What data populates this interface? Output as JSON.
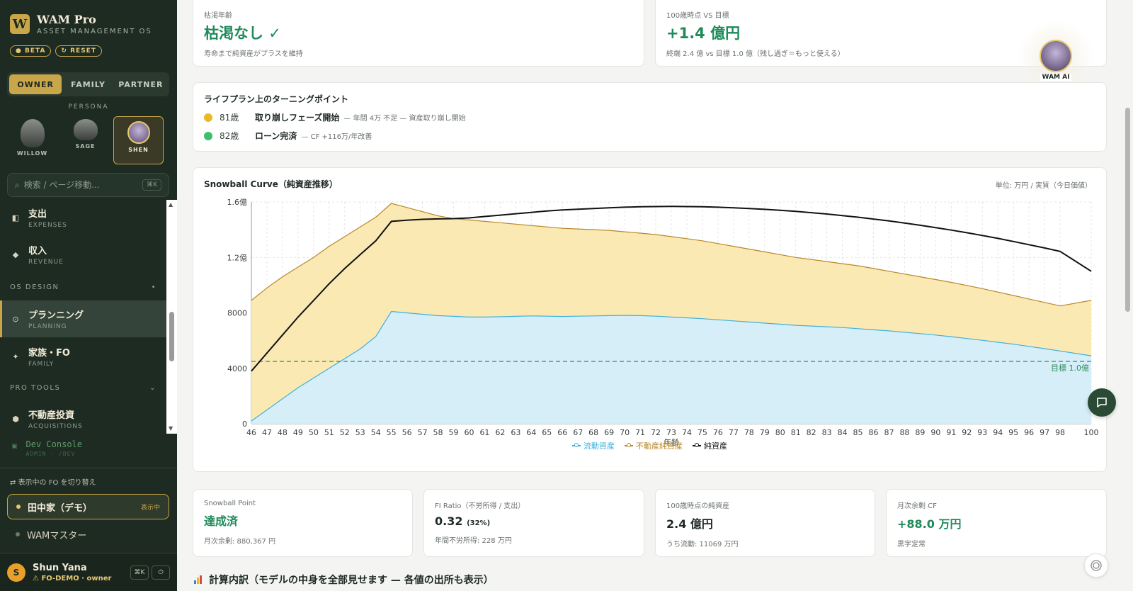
{
  "brand": {
    "logo": "W",
    "name": "WAM Pro",
    "subtitle": "ASSET MANAGEMENT OS",
    "badge_beta": "BETA",
    "badge_reset": "RESET"
  },
  "role_tabs": [
    {
      "label": "OWNER",
      "active": true
    },
    {
      "label": "FAMILY",
      "active": false
    },
    {
      "label": "PARTNER",
      "active": false
    }
  ],
  "persona": {
    "label": "PERSONA",
    "items": [
      {
        "name": "WILLOW",
        "active": false
      },
      {
        "name": "SAGE",
        "active": false
      },
      {
        "name": "SHEN",
        "active": true
      }
    ]
  },
  "search": {
    "placeholder": "検索 / ページ移動...",
    "shortcut": "⌘K"
  },
  "nav": {
    "items": [
      {
        "label": "支出",
        "sub": "EXPENSES",
        "icon": "expenses-icon"
      },
      {
        "label": "収入",
        "sub": "REVENUE",
        "icon": "revenue-icon"
      },
      {
        "label": "プランニング",
        "sub": "PLANNING",
        "icon": "planning-icon",
        "active": true
      },
      {
        "label": "家族・FO",
        "sub": "FAMILY",
        "icon": "family-icon"
      },
      {
        "label": "不動産投資",
        "sub": "ACQUISITIONS",
        "icon": "acquisitions-icon"
      }
    ],
    "section_os_design": "OS DESIGN",
    "section_pro_tools": "PRO TOOLS",
    "dev_label": "Dev Console",
    "dev_sub": "ADMIN · /DEV"
  },
  "fo": {
    "switch_label": "表示中の FO を切り替え",
    "items": [
      {
        "label": "田中家（デモ）",
        "tag": "表示中",
        "active": true
      },
      {
        "label": "WAMマスター",
        "tag": "",
        "active": false
      }
    ]
  },
  "user": {
    "initial": "S",
    "name": "Shun Yana",
    "role": "⚠ FO-DEMO · owner",
    "shortcut": "⌘K",
    "power": "⏻"
  },
  "top_cards": {
    "depletion": {
      "label": "枯渇年齢",
      "value": "枯渇なし ✓",
      "note": "寿命まで純資産がプラスを維持"
    },
    "target": {
      "label": "100歳時点 VS 目標",
      "value": "+1.4 億円",
      "note": "終端 2.4 億 vs 目標 1.0 億（残し過ぎ＝もっと使える）"
    }
  },
  "turning_points": {
    "title": "ライフプラン上のターニングポイント",
    "items": [
      {
        "age": "81歳",
        "event": "取り崩しフェーズ開始",
        "detail": "— 年間 4万 不足 — 資産取り崩し開始",
        "color": "#e8b92a"
      },
      {
        "age": "82歳",
        "event": "ローン完済",
        "detail": "— CF +116万/年改善",
        "color": "#3cc070"
      }
    ]
  },
  "chart_data": {
    "type": "area",
    "title": "Snowball Curve（純資産推移）",
    "unit_note": "単位: 万円 / 実質（今日価値）",
    "xlabel": "年齢",
    "x": [
      46,
      47,
      48,
      49,
      50,
      51,
      52,
      53,
      54,
      55,
      56,
      57,
      58,
      59,
      60,
      61,
      62,
      63,
      64,
      65,
      66,
      67,
      68,
      69,
      70,
      71,
      72,
      73,
      74,
      75,
      76,
      77,
      78,
      79,
      80,
      81,
      82,
      83,
      84,
      85,
      86,
      87,
      88,
      89,
      90,
      91,
      92,
      93,
      94,
      95,
      96,
      97,
      98,
      100
    ],
    "y_ticks": [
      {
        "v": 0,
        "label": "0"
      },
      {
        "v": 4000,
        "label": "4000"
      },
      {
        "v": 8000,
        "label": "8000"
      },
      {
        "v": 12000,
        "label": "1.2億"
      },
      {
        "v": 16000,
        "label": "1.6億"
      }
    ],
    "ylim": [
      0,
      16000
    ],
    "series": [
      {
        "name": "流動資産",
        "color": "#3fb1dc",
        "fill": "#d6eef8",
        "values": [
          200,
          1000,
          1800,
          2600,
          3300,
          4000,
          4700,
          5400,
          6300,
          8100,
          8000,
          7900,
          7800,
          7750,
          7700,
          7700,
          7720,
          7750,
          7780,
          7760,
          7740,
          7760,
          7780,
          7800,
          7820,
          7800,
          7760,
          7700,
          7640,
          7580,
          7500,
          7420,
          7340,
          7260,
          7180,
          7100,
          7050,
          7000,
          6940,
          6860,
          6780,
          6700,
          6600,
          6500,
          6400,
          6280,
          6150,
          6020,
          5880,
          5740,
          5580,
          5420,
          5250,
          4900
        ]
      },
      {
        "name": "不動産純資産",
        "color": "#b8872a",
        "fill": "#fbe9b4",
        "values": [
          8900,
          9800,
          10600,
          11300,
          12000,
          12800,
          13500,
          14200,
          14900,
          15900,
          15600,
          15300,
          15000,
          14800,
          14700,
          14600,
          14500,
          14400,
          14300,
          14200,
          14100,
          14050,
          14000,
          13950,
          13850,
          13750,
          13650,
          13500,
          13350,
          13200,
          13000,
          12800,
          12600,
          12400,
          12200,
          12000,
          11850,
          11700,
          11550,
          11400,
          11200,
          11000,
          10800,
          10600,
          10400,
          10200,
          9980,
          9750,
          9500,
          9250,
          9000,
          8750,
          8500,
          8900
        ]
      },
      {
        "name": "純資産",
        "color": "#111111",
        "values": [
          3800,
          5100,
          6400,
          7700,
          8900,
          10100,
          11200,
          12200,
          13200,
          14600,
          14680,
          14750,
          14780,
          14800,
          14850,
          14950,
          15050,
          15150,
          15250,
          15350,
          15420,
          15480,
          15530,
          15580,
          15620,
          15650,
          15670,
          15680,
          15670,
          15650,
          15620,
          15580,
          15530,
          15470,
          15400,
          15320,
          15230,
          15130,
          15020,
          14900,
          14770,
          14630,
          14480,
          14320,
          14150,
          13970,
          13780,
          13580,
          13370,
          13150,
          12920,
          12680,
          12430,
          11000
        ]
      }
    ],
    "target_line": {
      "value": 4500,
      "label": "目標 1.0億",
      "color": "#2f8a5a"
    }
  },
  "metrics": [
    {
      "title": "Snowball Point",
      "value": "達成済",
      "extra": "",
      "note": "月次余剰: 880,367 円",
      "green": true
    },
    {
      "title": "FI Ratio（不労所得 / 支出）",
      "value": "0.32",
      "extra": "(32%)",
      "note": "年間不労所得: 228 万円",
      "green": false
    },
    {
      "title": "100歳時点の純資産",
      "value": "2.4 億円",
      "extra": "",
      "note": "うち流動: 11069 万円",
      "green": false
    },
    {
      "title": "月次余剰 CF",
      "value": "+88.0 万円",
      "extra": "",
      "note": "黒字定常",
      "green": true
    }
  ],
  "calc": {
    "title": "計算内訳（モデルの中身を全部見せます — 各値の出所も表示）"
  },
  "assistant": {
    "label": "WAM AI"
  }
}
